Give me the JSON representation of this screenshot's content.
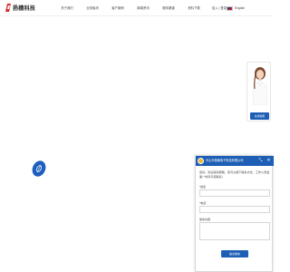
{
  "header": {
    "logo_cn": "扬穗科技",
    "logo_en": "YANG SUI TECHNOLOGY",
    "nav": [
      {
        "label": "关于我们",
        "icon": "none"
      },
      {
        "label": "业务板块",
        "icon": "none"
      },
      {
        "label": "客户案例",
        "icon": "none"
      },
      {
        "label": "新闻资讯",
        "icon": "none"
      },
      {
        "label": "服务渠道",
        "icon": "none"
      },
      {
        "label": "资料下载",
        "icon": "none"
      },
      {
        "label": "加入 | 登录",
        "icon": "none"
      }
    ],
    "language": "English",
    "language_icon": "us-flag-icon"
  },
  "colors": {
    "brand_blue": "#1e5fb5",
    "logo_red": "#d92b2b"
  },
  "consult": {
    "button_label": "在线客服"
  },
  "chat": {
    "title": "中山市扬穗电子科技有限公司",
    "message": "您好，欢迎来到扬穗，您可以留下联系方式，工作人员会第一时间与您联系！",
    "fields": [
      {
        "label": "*姓名"
      },
      {
        "label": "*电话"
      }
    ],
    "textarea_label": "留言内容",
    "submit_label": "提交留言"
  }
}
